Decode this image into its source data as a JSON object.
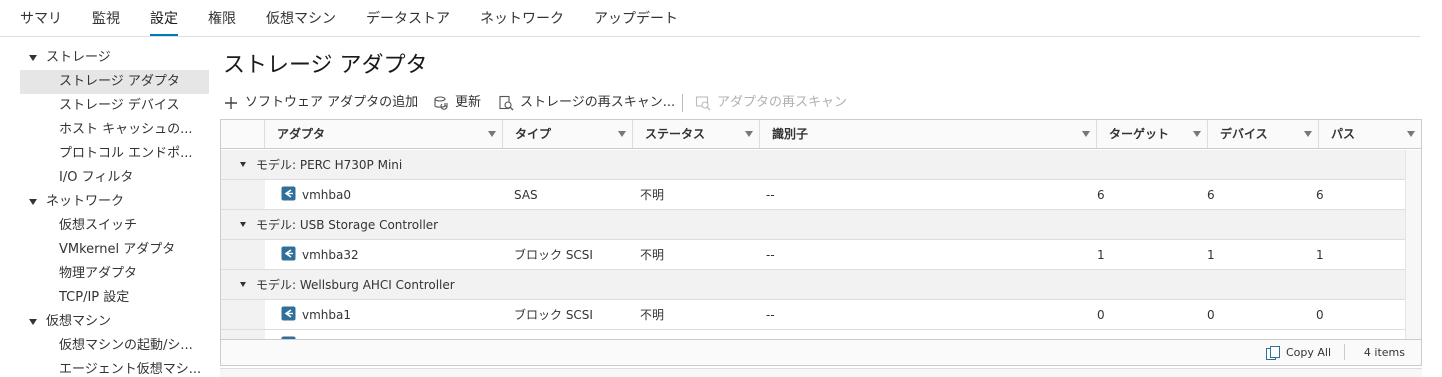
{
  "tabs": [
    "サマリ",
    "監視",
    "設定",
    "権限",
    "仮想マシン",
    "データストア",
    "ネットワーク",
    "アップデート"
  ],
  "active_tab": "設定",
  "sidebar": {
    "items": [
      {
        "label": "ストレージ",
        "type": "section",
        "expanded": true
      },
      {
        "label": "ストレージ アダプタ",
        "type": "item",
        "selected": true
      },
      {
        "label": "ストレージ デバイス",
        "type": "item"
      },
      {
        "label": "ホスト キャッシュの...",
        "type": "item"
      },
      {
        "label": "プロトコル エンドポ...",
        "type": "item"
      },
      {
        "label": "I/O フィルタ",
        "type": "item"
      },
      {
        "label": "ネットワーク",
        "type": "section",
        "expanded": true
      },
      {
        "label": "仮想スイッチ",
        "type": "item"
      },
      {
        "label": "VMkernel アダプタ",
        "type": "item"
      },
      {
        "label": "物理アダプタ",
        "type": "item"
      },
      {
        "label": "TCP/IP 設定",
        "type": "item"
      },
      {
        "label": "仮想マシン",
        "type": "section",
        "expanded": true
      },
      {
        "label": "仮想マシンの起動/シ...",
        "type": "item"
      },
      {
        "label": "エージェント仮想マシ...",
        "type": "item"
      }
    ]
  },
  "main": {
    "title": "ストレージ アダプタ",
    "toolbar": {
      "add_label": "ソフトウェア アダプタの追加",
      "refresh_label": "更新",
      "rescan_storage_label": "ストレージの再スキャン...",
      "rescan_adapter_label": "アダプタの再スキャン"
    }
  },
  "grid": {
    "columns": [
      "アダプタ",
      "タイプ",
      "ステータス",
      "識別子",
      "ターゲット",
      "デバイス",
      "パス"
    ],
    "groups": [
      {
        "label": "モデル: PERC H730P Mini",
        "rows": [
          {
            "adapter": "vmhba0",
            "type": "SAS",
            "status": "不明",
            "identifier": "--",
            "targets": "6",
            "devices": "6",
            "paths": "6"
          }
        ]
      },
      {
        "label": "モデル: USB Storage Controller",
        "rows": [
          {
            "adapter": "vmhba32",
            "type": "ブロック SCSI",
            "status": "不明",
            "identifier": "--",
            "targets": "1",
            "devices": "1",
            "paths": "1"
          }
        ]
      },
      {
        "label": "モデル: Wellsburg AHCI Controller",
        "rows": [
          {
            "adapter": "vmhba1",
            "type": "ブロック SCSI",
            "status": "不明",
            "identifier": "--",
            "targets": "0",
            "devices": "0",
            "paths": "0"
          }
        ]
      }
    ],
    "footer": {
      "copy_all_label": "Copy All",
      "item_count": "4 items"
    }
  },
  "icons": {
    "add": "plus-icon",
    "refresh": "refresh-icon",
    "rescan_storage": "rescan-storage-icon",
    "rescan_adapter": "rescan-adapter-icon",
    "adapter": "storage-adapter-icon",
    "copy": "copy-icon",
    "filter": "filter-icon"
  },
  "colors": {
    "accent": "#0079b8",
    "adapter_icon": "#2f6f99"
  }
}
